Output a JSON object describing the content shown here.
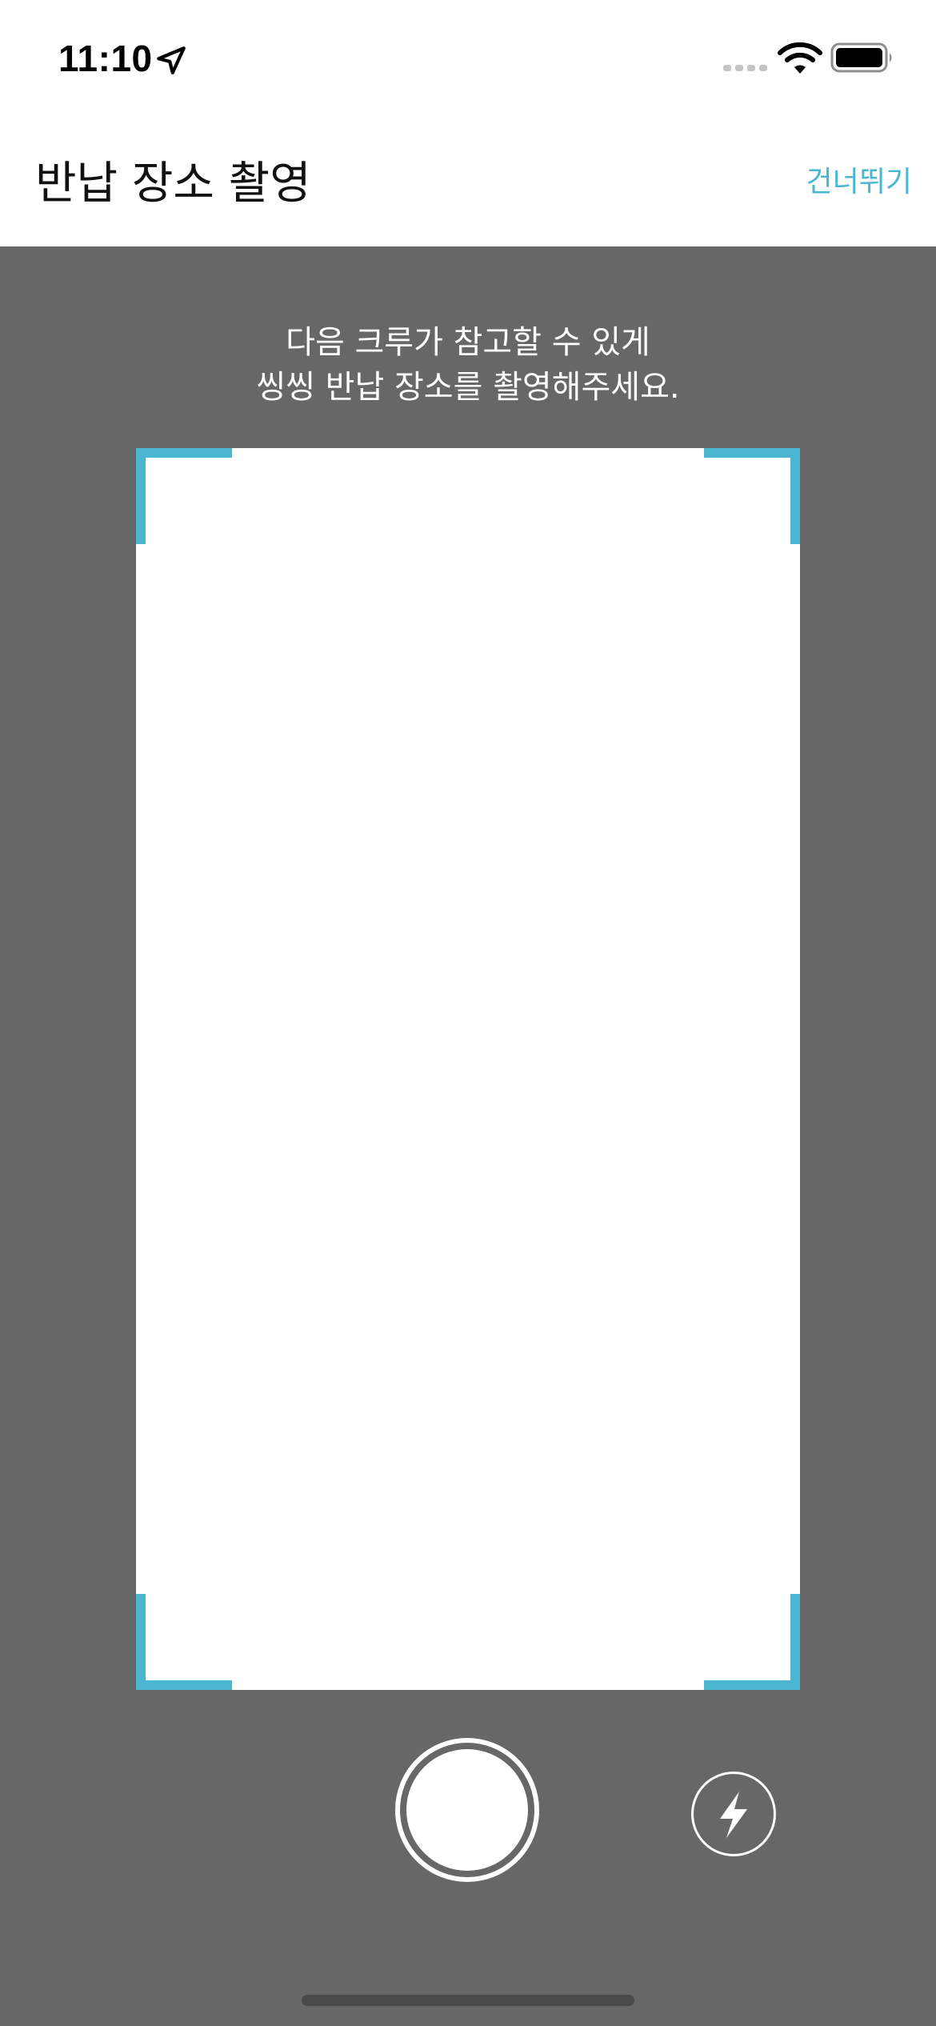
{
  "status_bar": {
    "time": "11:10",
    "icons": [
      "location-arrow-icon",
      "cellular-signal-icon",
      "wifi-icon",
      "battery-icon"
    ]
  },
  "nav": {
    "title": "반납 장소 촬영",
    "skip_label": "건너뛰기"
  },
  "camera": {
    "instruction_line1": "다음 크루가 참고할 수 있게",
    "instruction_line2": "씽씽 반납 장소를 촬영해주세요.",
    "shutter_icon": "shutter-icon",
    "flash_icon": "flash-icon"
  },
  "colors": {
    "accent": "#4ab6cf",
    "background": "#676767",
    "viewfinder": "#ffffff"
  }
}
